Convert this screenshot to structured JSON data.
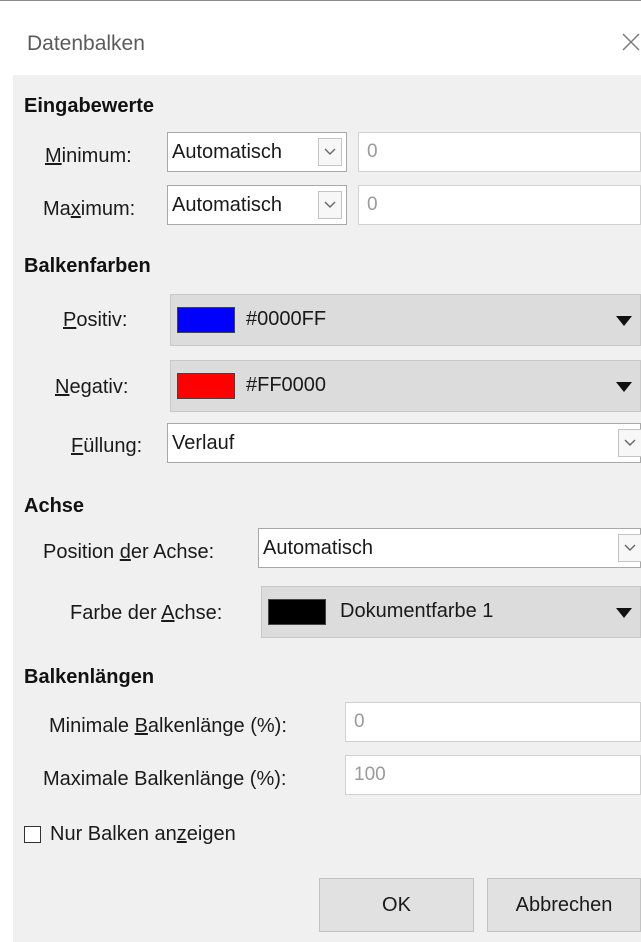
{
  "window": {
    "title": "Datenbalken",
    "close_icon": "close-icon"
  },
  "sections": {
    "input_values": "Eingabewerte",
    "bar_colors": "Balkenfarben",
    "axis": "Achse",
    "bar_lengths": "Balkenlängen"
  },
  "min": {
    "label_pre": "",
    "label_u": "M",
    "label_post": "inimum:",
    "mode": "Automatisch",
    "value": "0"
  },
  "max": {
    "label_pre": "Ma",
    "label_u": "x",
    "label_post": "imum:",
    "mode": "Automatisch",
    "value": "0"
  },
  "positive": {
    "label_pre": "",
    "label_u": "P",
    "label_post": "ositiv:",
    "color": "#0000FF",
    "color_name": "#0000FF"
  },
  "negative": {
    "label_pre": "",
    "label_u": "N",
    "label_post": "egativ:",
    "color": "#FF0000",
    "color_name": "#FF0000"
  },
  "fill": {
    "label_pre": "",
    "label_u": "F",
    "label_post": "üllung:",
    "value": "Verlauf"
  },
  "axis_position": {
    "label_pre": "Position ",
    "label_u": "d",
    "label_post": "er Achse:",
    "value": "Automatisch"
  },
  "axis_color": {
    "label_pre": "Farbe der ",
    "label_u": "A",
    "label_post": "chse:",
    "color": "#000000",
    "color_name": "Dokumentfarbe 1"
  },
  "min_length": {
    "label_pre": "Minimale ",
    "label_u": "B",
    "label_post": "alkenlänge (%):",
    "value": "0"
  },
  "max_length": {
    "label_pre": "Maximale Balkenlän",
    "label_u": "g",
    "label_post": "e (%):",
    "value": "100"
  },
  "only_bars": {
    "label_pre": "Nur Balken an",
    "label_u": "z",
    "label_post": "eigen",
    "checked": false
  },
  "buttons": {
    "ok": "OK",
    "cancel": "Abbrechen"
  }
}
